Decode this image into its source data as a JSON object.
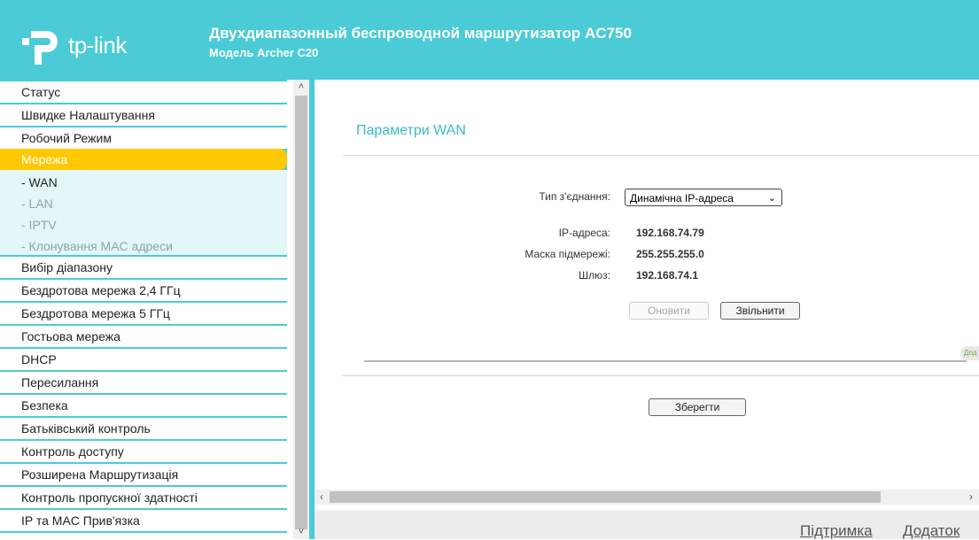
{
  "header": {
    "logo_text": "tp-link",
    "title": "Двухдиапазонный беспроводной маршрутизатор AC750",
    "subtitle": "Модель Archer C20"
  },
  "sidebar": {
    "items_before": [
      "Статус",
      "Швидке Налаштування",
      "Робочий Режим"
    ],
    "active": "Мережа",
    "subitems": [
      "- WAN",
      "- LAN",
      "- IPTV",
      "- Клонування MAC адреси"
    ],
    "items_after": [
      "Вибір діапазону",
      "Бездротова мережа 2,4 ГГц",
      "Бездротова мережа 5 ГГц",
      "Гостьова мережа",
      "DHCP",
      "Пересилання",
      "Безпека",
      "Батьківський контроль",
      "Контроль доступу",
      "Розширена Маршрутизація",
      "Контроль пропускної здатності",
      "IP та MAC Прив'язка"
    ]
  },
  "main": {
    "section_title": "Параметри WAN",
    "connection_type_label": "Тип з'єднання:",
    "connection_type_value": "Динамічна IP-адреса",
    "ip_label": "IP-адреса:",
    "ip_value": "192.168.74.79",
    "mask_label": "Маска підмережі:",
    "mask_value": "255.255.255.0",
    "gateway_label": "Шлюз:",
    "gateway_value": "192.168.74.1",
    "renew_button": "Оновити",
    "release_button": "Звільнити",
    "help_tab": "Дод",
    "save_button": "Зберегти"
  },
  "footer": {
    "support": "Підтримка",
    "app": "Додаток"
  },
  "colors": {
    "teal": "#4acbd6",
    "active_menu": "#ffc800",
    "section_title": "#3cb9c6"
  }
}
